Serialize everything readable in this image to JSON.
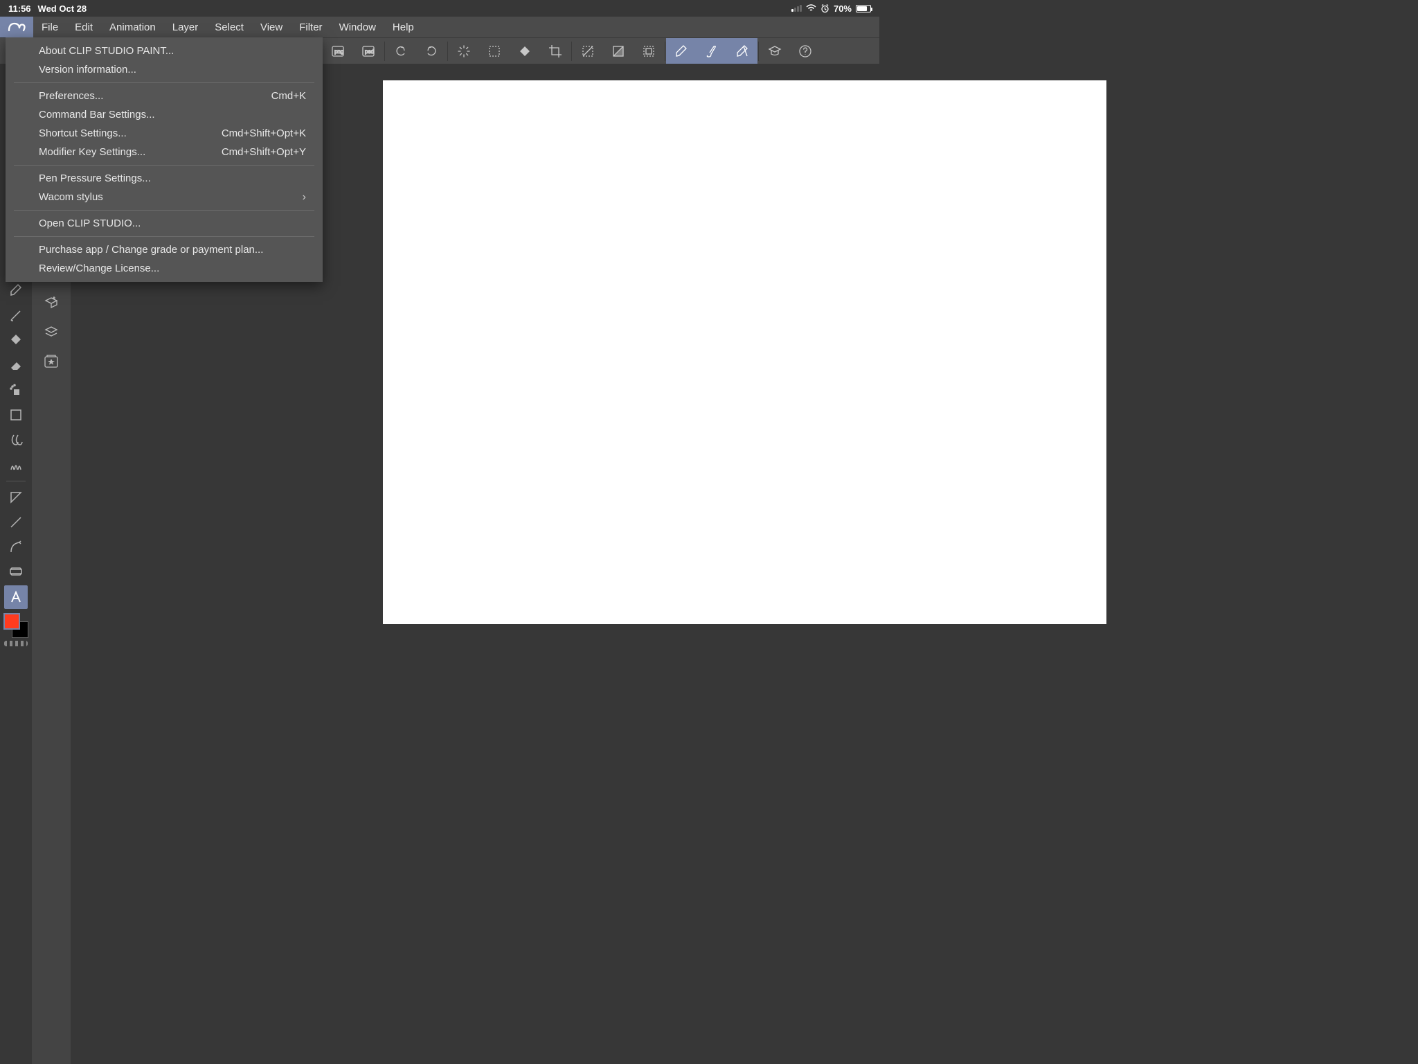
{
  "status": {
    "time": "11:56",
    "date": "Wed Oct 28",
    "battery": "70%"
  },
  "menu": {
    "items": [
      "File",
      "Edit",
      "Animation",
      "Layer",
      "Select",
      "View",
      "Filter",
      "Window",
      "Help"
    ]
  },
  "dropdown": {
    "about": "About CLIP STUDIO PAINT...",
    "version": "Version information...",
    "prefs": "Preferences...",
    "prefs_sc": "Cmd+K",
    "cmdbar": "Command Bar Settings...",
    "shortcut": "Shortcut Settings...",
    "shortcut_sc": "Cmd+Shift+Opt+K",
    "modifier": "Modifier Key Settings...",
    "modifier_sc": "Cmd+Shift+Opt+Y",
    "penpress": "Pen Pressure Settings...",
    "wacom": "Wacom stylus",
    "openclip": "Open CLIP STUDIO...",
    "purchase": "Purchase app / Change grade or payment plan...",
    "review": "Review/Change License..."
  },
  "toolbar_icons": [
    "png",
    "psd",
    "undo",
    "redo",
    "loading",
    "select-all",
    "fill",
    "crop",
    "snap-off",
    "snap-grid",
    "snap-selection",
    "pen-mode",
    "brush-mode",
    "eraser-mode",
    "education",
    "help"
  ],
  "colors": {
    "fg": "#ff3b1f",
    "bg": "#000000",
    "accent": "#7684a8"
  }
}
